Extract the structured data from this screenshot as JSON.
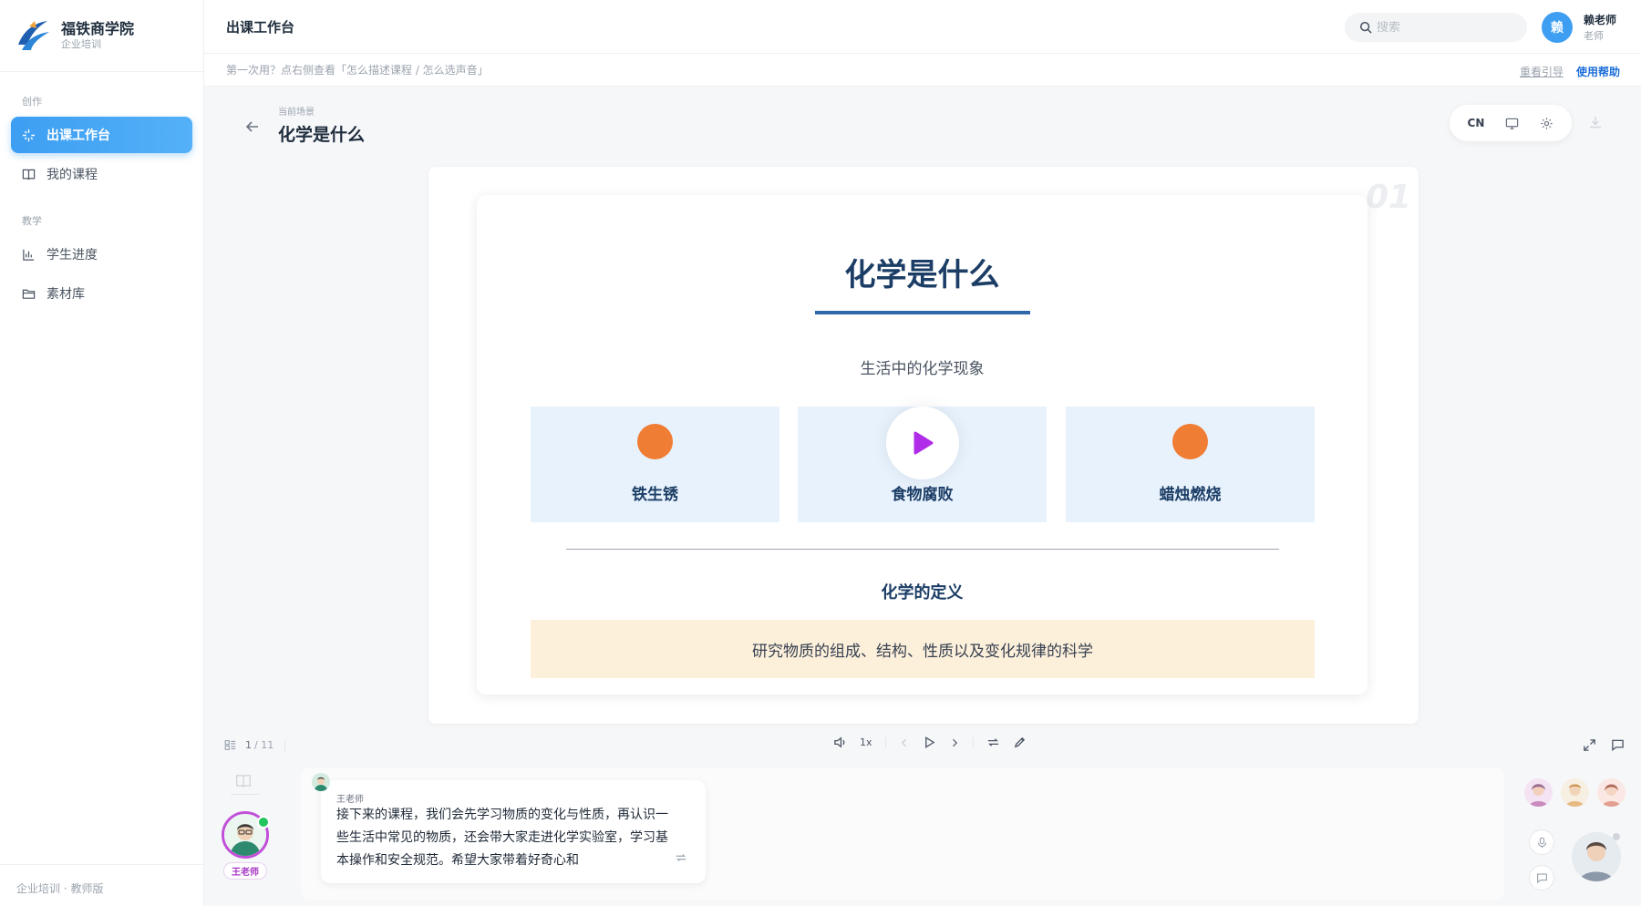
{
  "brand": {
    "title": "福铁商学院",
    "subtitle": "企业培训"
  },
  "sidebar": {
    "sections": [
      {
        "label": "创作",
        "items": [
          {
            "label": "出课工作台",
            "active": true,
            "icon": "sparkle-icon"
          },
          {
            "label": "我的课程",
            "active": false,
            "icon": "book-icon"
          }
        ]
      },
      {
        "label": "教学",
        "items": [
          {
            "label": "学生进度",
            "active": false,
            "icon": "bar-chart-icon"
          },
          {
            "label": "素材库",
            "active": false,
            "icon": "folder-icon"
          }
        ]
      }
    ],
    "footer": "企业培训 · 教师版"
  },
  "header": {
    "title": "出课工作台",
    "search_placeholder": "搜索",
    "avatar_initial": "赖",
    "user_name": "赖老师",
    "user_role": "老师"
  },
  "hint": {
    "text": "第一次用？点右侧查看「怎么描述课程 / 怎么选声音」",
    "replay_link": "重看引导",
    "help_link": "使用帮助"
  },
  "scene": {
    "label": "当前场景",
    "title": "化学是什么",
    "lang": "CN"
  },
  "slide": {
    "number": "01",
    "title": "化学是什么",
    "subtitle": "生活中的化学现象",
    "cards": [
      {
        "label": "铁生锈",
        "media": "orange-dot"
      },
      {
        "label": "食物腐败",
        "media": "play-icon"
      },
      {
        "label": "蜡烛燃烧",
        "media": "orange-dot"
      }
    ],
    "definition_title": "化学的定义",
    "definition_text": "研究物质的组成、结构、性质以及变化规律的科学"
  },
  "player": {
    "page": "1",
    "total": "/ 11",
    "speed": "1x"
  },
  "teacher": {
    "tag": "王老师"
  },
  "chat": {
    "sender": "王老师",
    "text": "接下来的课程，我们会先学习物质的变化与性质，再认识一些生活中常见的物质，还会带大家走进化学实验室，学习基本操作和安全规范。希望大家带着好奇心和"
  },
  "colors": {
    "accent": "#3d9ef2",
    "slide_title": "#1c3e66",
    "dot": "#ef7d34",
    "play": "#b02ce8",
    "card_bg": "#e8f2fd",
    "definition_bg": "#fdf0db"
  }
}
